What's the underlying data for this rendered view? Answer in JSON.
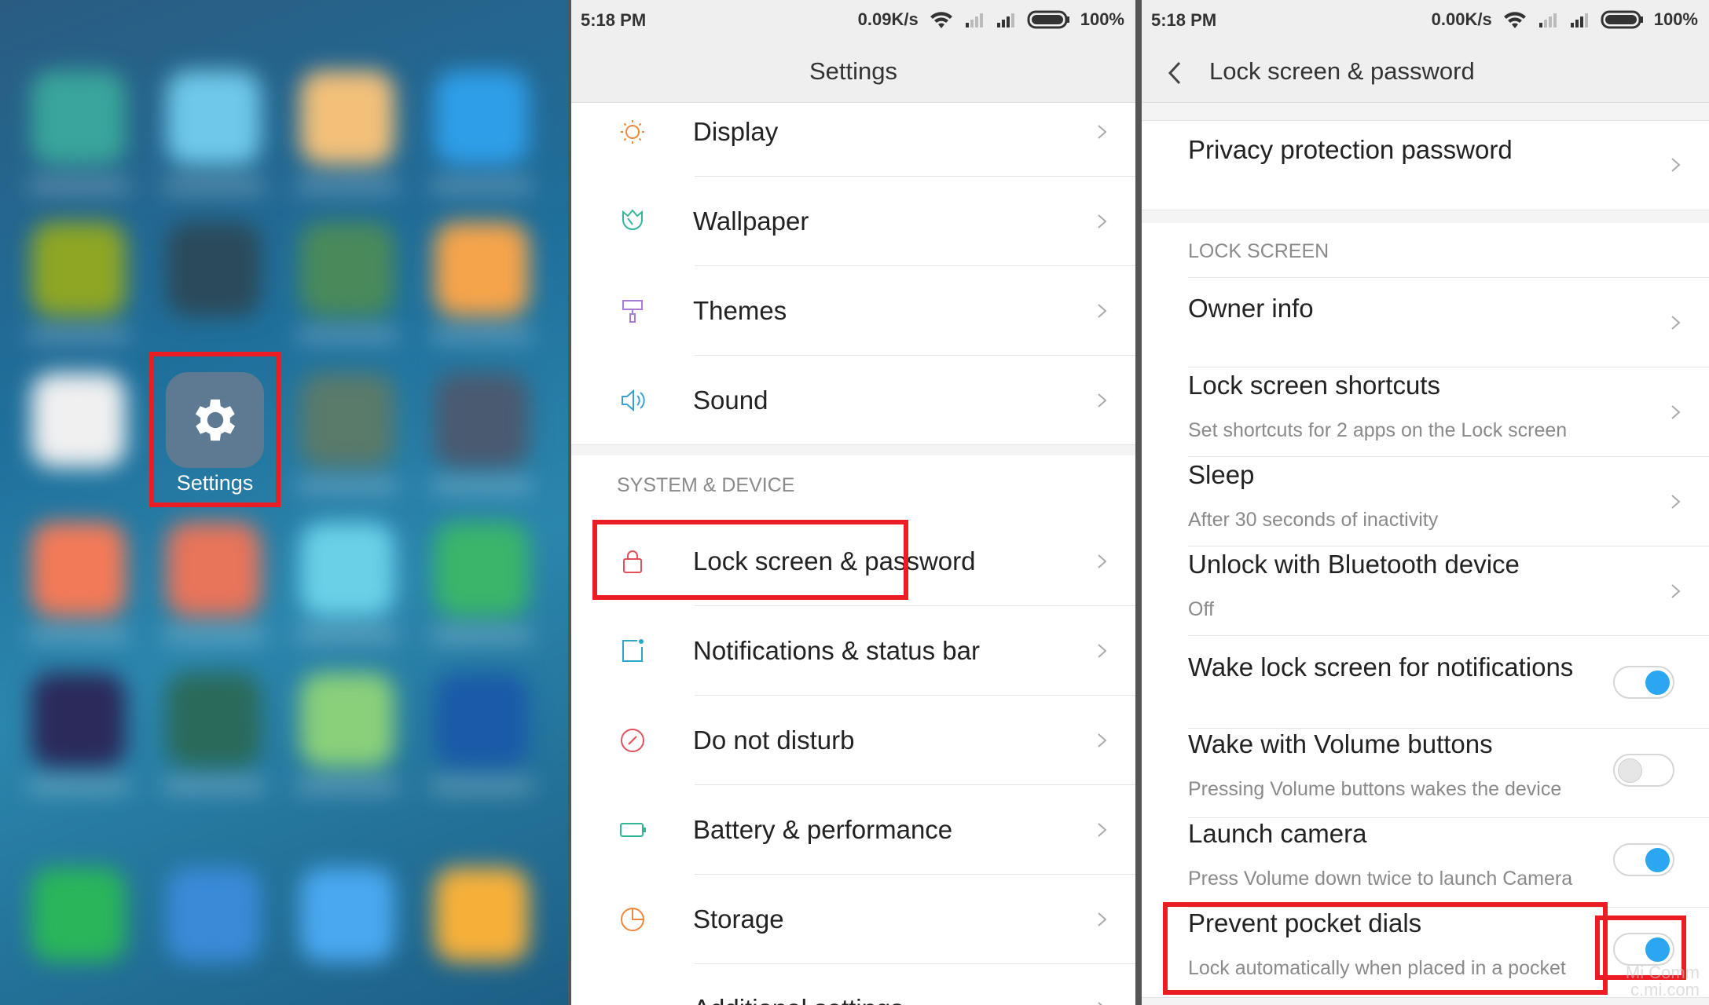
{
  "home": {
    "settings_label": "Settings",
    "colors": {
      "highlight": "#ec1c24"
    }
  },
  "settings": {
    "status": {
      "time": "5:18 PM",
      "speed": "0.09K/s",
      "battery": "100%"
    },
    "title": "Settings",
    "items_top": [
      {
        "label": "Display",
        "icon": "sun-icon",
        "color": "#f0883a"
      },
      {
        "label": "Wallpaper",
        "icon": "tulip-icon",
        "color": "#35b59a"
      },
      {
        "label": "Themes",
        "icon": "paint-roller-icon",
        "color": "#a77bd6"
      },
      {
        "label": "Sound",
        "icon": "speaker-icon",
        "color": "#3aa0d0"
      }
    ],
    "section": "SYSTEM & DEVICE",
    "items_bottom": [
      {
        "label": "Lock screen & password",
        "icon": "lock-icon",
        "color": "#e2505a"
      },
      {
        "label": "Notifications & status bar",
        "icon": "notification-icon",
        "color": "#2aa7c9"
      },
      {
        "label": "Do not disturb",
        "icon": "do-not-disturb-icon",
        "color": "#e2505a"
      },
      {
        "label": "Battery & performance",
        "icon": "battery-icon",
        "color": "#35b59a"
      },
      {
        "label": "Storage",
        "icon": "pie-chart-icon",
        "color": "#f0883a"
      },
      {
        "label": "Additional settings",
        "icon": "more-icon",
        "color": "#3aa0d0"
      }
    ]
  },
  "lock": {
    "status": {
      "time": "5:18 PM",
      "speed": "0.00K/s",
      "battery": "100%"
    },
    "title": "Lock screen & password",
    "privacy": "Privacy protection password",
    "section": "LOCK SCREEN",
    "owner_info": "Owner info",
    "shortcuts": {
      "label": "Lock screen shortcuts",
      "sub": "Set shortcuts for 2 apps on the Lock screen"
    },
    "sleep": {
      "label": "Sleep",
      "sub": "After 30 seconds of inactivity"
    },
    "bluetooth": {
      "label": "Unlock with Bluetooth device",
      "sub": "Off"
    },
    "wake_notif": {
      "label": "Wake lock screen for notifications",
      "on": true
    },
    "wake_volume": {
      "label": "Wake with Volume buttons",
      "sub": "Pressing Volume buttons wakes the device",
      "on": false
    },
    "camera": {
      "label": "Launch camera",
      "sub": "Press Volume down twice to launch Camera",
      "on": true
    },
    "pocket": {
      "label": "Prevent pocket dials",
      "sub": "Lock automatically when placed in a pocket",
      "on": true
    }
  },
  "watermark": {
    "line1": "Mi Comm",
    "line2": "c.mi.com"
  }
}
